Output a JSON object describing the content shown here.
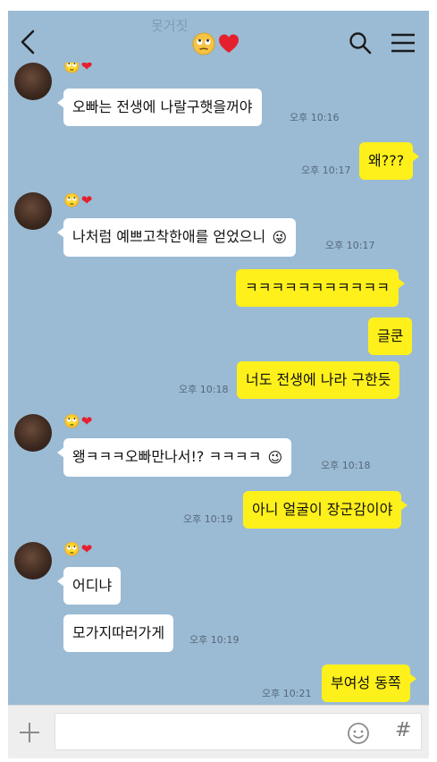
{
  "header": {
    "faded_text": "못거짓",
    "title_emoji_1": "🙄",
    "title_emoji_2": "❤"
  },
  "contact": {
    "emoji_1": "🙄",
    "emoji_2": "❤"
  },
  "messages": [
    {
      "side": "them",
      "text": "오빠는 전생에 나랄구햇을꺼야",
      "time": "오후 10:16"
    },
    {
      "side": "me",
      "text": "왜???",
      "time": "오후 10:17"
    },
    {
      "side": "them",
      "text": "나처럼 예쁘고착한애를 얻었으니",
      "emoji": "😜",
      "time": "오후 10:17"
    },
    {
      "side": "me",
      "text": "ㅋㅋㅋㅋㅋㅋㅋㅋㅋㅋㅋ"
    },
    {
      "side": "me",
      "text": "글쿤"
    },
    {
      "side": "me",
      "text": "너도 전생에 나라 구한듯",
      "time": "오후 10:18"
    },
    {
      "side": "them",
      "text": "왱ㅋㅋㅋ오빠만나서!? ㅋㅋㅋㅋ",
      "emoji": "😉",
      "time": "오후 10:18"
    },
    {
      "side": "me",
      "text": "아니 얼굴이 장군감이야",
      "time": "오후 10:19"
    },
    {
      "side": "them",
      "text": "어디냐"
    },
    {
      "side": "them",
      "text": "모가지따러가게",
      "time": "오후 10:19"
    },
    {
      "side": "me",
      "text": "부여성 동쪽",
      "time": "오후 10:21"
    }
  ],
  "input": {
    "hash_symbol": "#"
  },
  "colors": {
    "chat_background": "#9bbbd4",
    "my_bubble": "#fef01b",
    "their_bubble": "#ffffff"
  }
}
